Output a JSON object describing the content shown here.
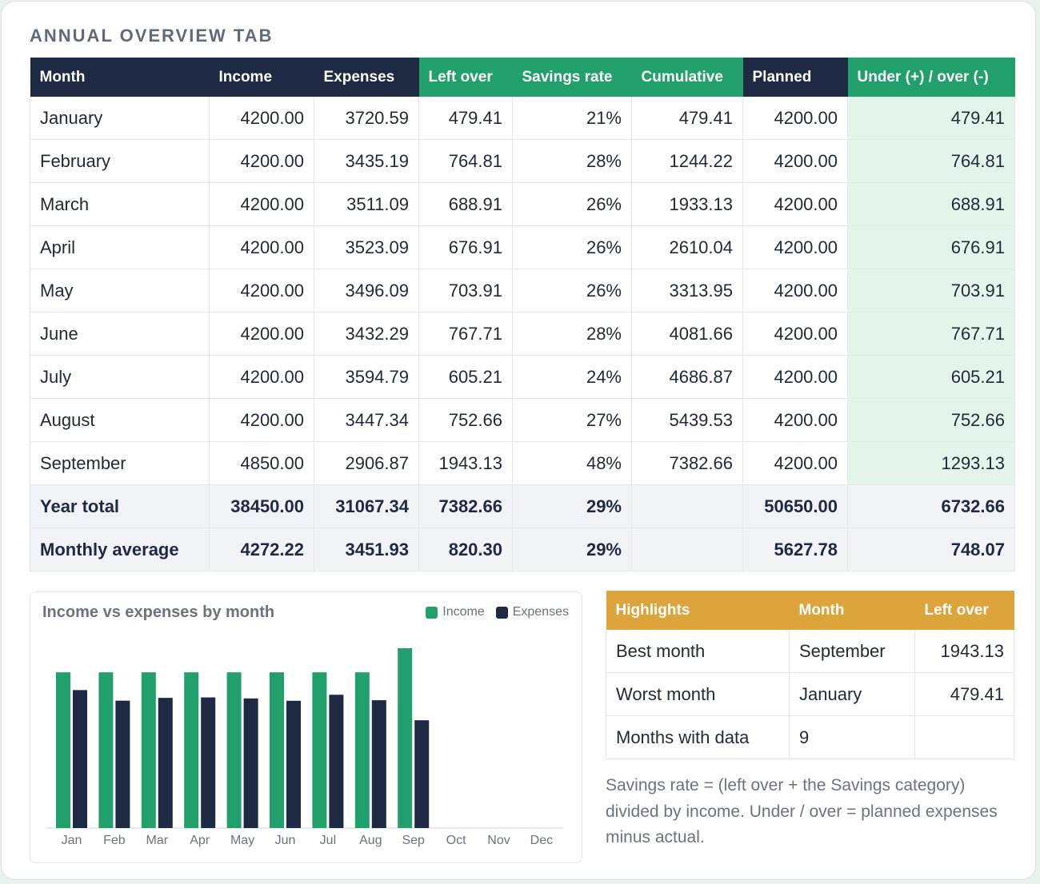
{
  "title": "ANNUAL OVERVIEW TAB",
  "colors": {
    "green": "#22a06b",
    "navy": "#1e2a44",
    "gold": "#dea43c",
    "highlight_bg": "#e3f5eb"
  },
  "table": {
    "headers": [
      "Month",
      "Income",
      "Expenses",
      "Left over",
      "Savings rate",
      "Cumulative",
      "Planned",
      "Under (+) / over (-)"
    ],
    "rows": [
      [
        "January",
        "4200.00",
        "3720.59",
        "479.41",
        "21%",
        "479.41",
        "4200.00",
        "479.41"
      ],
      [
        "February",
        "4200.00",
        "3435.19",
        "764.81",
        "28%",
        "1244.22",
        "4200.00",
        "764.81"
      ],
      [
        "March",
        "4200.00",
        "3511.09",
        "688.91",
        "26%",
        "1933.13",
        "4200.00",
        "688.91"
      ],
      [
        "April",
        "4200.00",
        "3523.09",
        "676.91",
        "26%",
        "2610.04",
        "4200.00",
        "676.91"
      ],
      [
        "May",
        "4200.00",
        "3496.09",
        "703.91",
        "26%",
        "3313.95",
        "4200.00",
        "703.91"
      ],
      [
        "June",
        "4200.00",
        "3432.29",
        "767.71",
        "28%",
        "4081.66",
        "4200.00",
        "767.71"
      ],
      [
        "July",
        "4200.00",
        "3594.79",
        "605.21",
        "24%",
        "4686.87",
        "4200.00",
        "605.21"
      ],
      [
        "August",
        "4200.00",
        "3447.34",
        "752.66",
        "27%",
        "5439.53",
        "4200.00",
        "752.66"
      ],
      [
        "September",
        "4850.00",
        "2906.87",
        "1943.13",
        "48%",
        "7382.66",
        "4200.00",
        "1293.13"
      ]
    ],
    "totals": [
      [
        "Year total",
        "38450.00",
        "31067.34",
        "7382.66",
        "29%",
        "",
        "50650.00",
        "6732.66"
      ],
      [
        "Monthly average",
        "4272.22",
        "3451.93",
        "820.30",
        "29%",
        "",
        "5627.78",
        "748.07"
      ]
    ]
  },
  "chart": {
    "title": "Income vs expenses by month",
    "legend": {
      "income": "Income",
      "expenses": "Expenses"
    }
  },
  "chart_data": {
    "type": "bar",
    "title": "Income vs expenses by month",
    "categories": [
      "Jan",
      "Feb",
      "Mar",
      "Apr",
      "May",
      "Jun",
      "Jul",
      "Aug",
      "Sep",
      "Oct",
      "Nov",
      "Dec"
    ],
    "series": [
      {
        "name": "Income",
        "color": "#22a06b",
        "values": [
          4200,
          4200,
          4200,
          4200,
          4200,
          4200,
          4200,
          4200,
          4850,
          null,
          null,
          null
        ]
      },
      {
        "name": "Expenses",
        "color": "#1e2a44",
        "values": [
          3720.59,
          3435.19,
          3511.09,
          3523.09,
          3496.09,
          3432.29,
          3594.79,
          3447.34,
          2906.87,
          null,
          null,
          null
        ]
      }
    ],
    "ylim": [
      0,
      4850
    ],
    "grid": false,
    "legend_position": "top-right"
  },
  "highlights": {
    "headers": [
      "Highlights",
      "Month",
      "Left over"
    ],
    "rows": [
      [
        "Best month",
        "September",
        "1943.13"
      ],
      [
        "Worst month",
        "January",
        "479.41"
      ],
      [
        "Months with data",
        "9",
        ""
      ]
    ]
  },
  "note": "Savings rate = (left over + the Savings category) divided by income. Under / over = planned expenses minus actual."
}
